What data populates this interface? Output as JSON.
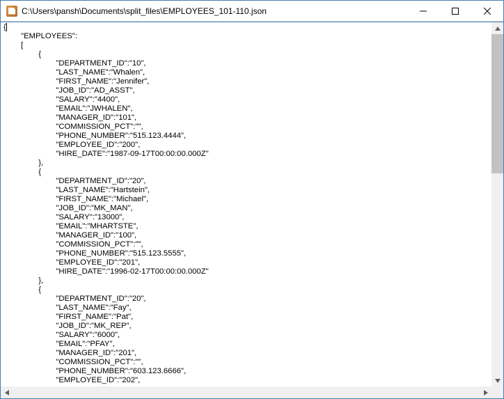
{
  "window": {
    "title": "C:\\Users\\pansh\\Documents\\split_files\\EMPLOYEES_101-110.json"
  },
  "root_key": "EMPLOYEES",
  "records": [
    {
      "DEPARTMENT_ID": "10",
      "LAST_NAME": "Whalen",
      "FIRST_NAME": "Jennifer",
      "JOB_ID": "AD_ASST",
      "SALARY": "4400",
      "EMAIL": "JWHALEN",
      "MANAGER_ID": "101",
      "COMMISSION_PCT": "",
      "PHONE_NUMBER": "515.123.4444",
      "EMPLOYEE_ID": "200",
      "HIRE_DATE": "1987-09-17T00:00:00.000Z"
    },
    {
      "DEPARTMENT_ID": "20",
      "LAST_NAME": "Hartstein",
      "FIRST_NAME": "Michael",
      "JOB_ID": "MK_MAN",
      "SALARY": "13000",
      "EMAIL": "MHARTSTE",
      "MANAGER_ID": "100",
      "COMMISSION_PCT": "",
      "PHONE_NUMBER": "515.123.5555",
      "EMPLOYEE_ID": "201",
      "HIRE_DATE": "1996-02-17T00:00:00.000Z"
    },
    {
      "DEPARTMENT_ID": "20",
      "LAST_NAME": "Fay",
      "FIRST_NAME": "Pat",
      "JOB_ID": "MK_REP",
      "SALARY": "6000",
      "EMAIL": "PFAY",
      "MANAGER_ID": "201",
      "COMMISSION_PCT": "",
      "PHONE_NUMBER": "603.123.6666",
      "EMPLOYEE_ID": "202"
    }
  ],
  "field_order": [
    "DEPARTMENT_ID",
    "LAST_NAME",
    "FIRST_NAME",
    "JOB_ID",
    "SALARY",
    "EMAIL",
    "MANAGER_ID",
    "COMMISSION_PCT",
    "PHONE_NUMBER",
    "EMPLOYEE_ID",
    "HIRE_DATE"
  ],
  "last_record_truncated": true
}
